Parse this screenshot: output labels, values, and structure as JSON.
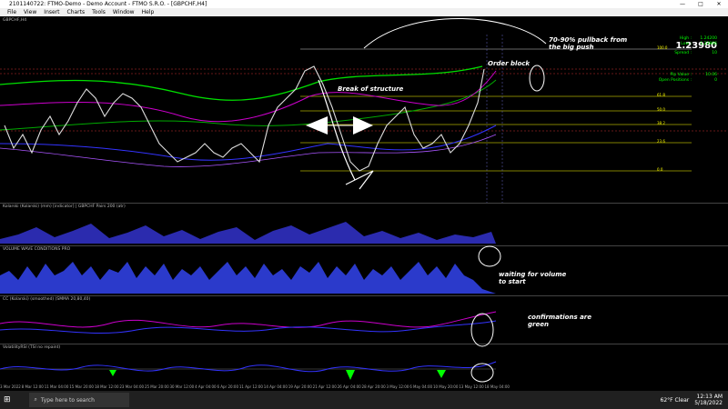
{
  "window": {
    "title": "2101140722: FTMO-Demo - Demo Account - FTMO S.R.O. - [GBPCHF,H4]",
    "controls": [
      "—",
      "□",
      "✕"
    ]
  },
  "menu": [
    "File",
    "View",
    "Insert",
    "Charts",
    "Tools",
    "Window",
    "Help"
  ],
  "chart": {
    "symbol_label": "GBPCHF,H4",
    "price": "1.23980",
    "high_label": "High :",
    "high": "1.24200",
    "low_label": "Low :",
    "low": "1.23906",
    "spread_label": "Spread :",
    "spread": "10",
    "pip_value_label": "Pip Value :",
    "pip_value": "10.06",
    "open_positions_label": "Open Positions :",
    "open_positions": "0",
    "fib_levels": [
      "100.0",
      "61.8",
      "50.0",
      "38.2",
      "23.6",
      "0.0"
    ],
    "dates": [
      "3 Mar 2022",
      "8 Mar 12:00",
      "11 Mar 04:00",
      "15 Mar 20:00",
      "18 Mar 12:00",
      "23 Mar 04:00",
      "25 Mar 20:00",
      "30 Mar 12:00",
      "4 Apr 04:00",
      "6 Apr 20:00",
      "11 Apr 12:00",
      "14 Apr 04:00",
      "19 Apr 20:00",
      "21 Apr 12:00",
      "26 Apr 04:00",
      "28 Apr 20:00",
      "3 May 12:00",
      "6 May 04:00",
      "10 May 20:00",
      "13 May 12:00",
      "18 May 04:00"
    ],
    "panels": [
      "Kolarski (Kolarski) (mm) [indicator] | GBPCHF Pairs 200 (atr)",
      "VOLUME WAVE CONDITIONS PRO",
      "CC (Kolarski) (smoothed) (SMMA 20,80,40)",
      "VolatilityRSI (TSI no repaint)"
    ]
  },
  "annotations": {
    "pullback": "70-90% pullback from the big push",
    "order_block": "Order block",
    "break_of_structure": "Break of structure",
    "waiting_volume": "waiting for volume to start",
    "confirmations": "confirmations are green"
  },
  "taskbar": {
    "search_placeholder": "Type here to search",
    "weather": "62°F  Clear",
    "time": "12:13 AM",
    "date": "5/18/2022"
  }
}
